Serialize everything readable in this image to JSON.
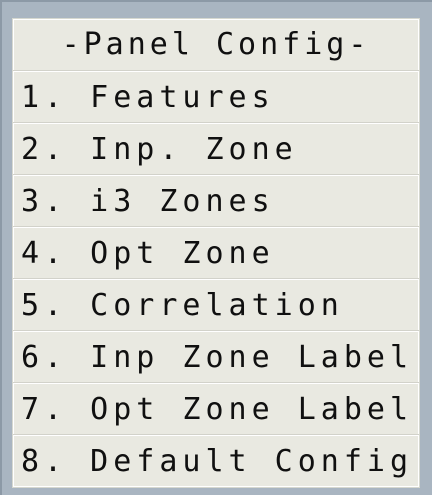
{
  "menu": {
    "title": "-Panel Config-",
    "items": [
      {
        "label": "1. Features"
      },
      {
        "label": "2. Inp. Zone"
      },
      {
        "label": "3. i3 Zones"
      },
      {
        "label": "4. Opt Zone"
      },
      {
        "label": "5. Correlation"
      },
      {
        "label": "6. Inp Zone Label"
      },
      {
        "label": "7. Opt Zone Label"
      },
      {
        "label": "8. Default Config"
      }
    ]
  },
  "colors": {
    "background": "#a9b5c1",
    "panel": "#e9e9e1",
    "text": "#101010"
  }
}
